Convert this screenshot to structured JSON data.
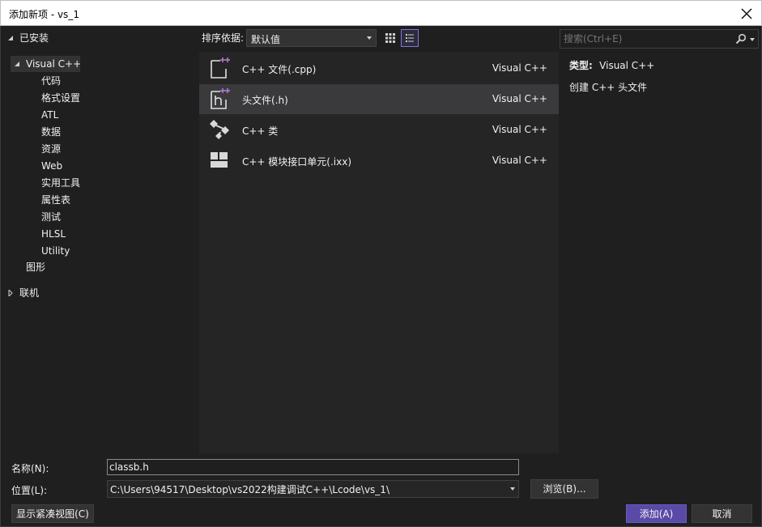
{
  "window": {
    "title": "添加新项 - vs_1"
  },
  "tree": {
    "installed_label": "已安装",
    "visual_cpp_label": "Visual C++",
    "children": [
      "代码",
      "格式设置",
      "ATL",
      "数据",
      "资源",
      "Web",
      "实用工具",
      "属性表",
      "测试",
      "HLSL",
      "Utility"
    ],
    "graphics_label": "图形",
    "online_label": "联机"
  },
  "toolbar": {
    "sort_label": "排序依据:",
    "sort_value": "默认值",
    "search_placeholder": "搜索(Ctrl+E)"
  },
  "templates": [
    {
      "name": "C++ 文件(.cpp)",
      "category": "Visual C++",
      "icon": "cpp-file-icon"
    },
    {
      "name": "头文件(.h)",
      "category": "Visual C++",
      "icon": "header-file-icon"
    },
    {
      "name": "C++ 类",
      "category": "Visual C++",
      "icon": "cpp-class-icon"
    },
    {
      "name": "C++ 模块接口单元(.ixx)",
      "category": "Visual C++",
      "icon": "module-interface-icon"
    }
  ],
  "details": {
    "type_label": "类型:",
    "type_value": "Visual C++",
    "description": "创建 C++ 头文件"
  },
  "form": {
    "name_label": "名称(N):",
    "name_value": "classb.h",
    "location_label": "位置(L):",
    "location_value": "C:\\Users\\94517\\Desktop\\vs2022构建调试C++\\Lcode\\vs_1\\",
    "browse_label": "浏览(B)...",
    "compact_view_label": "显示紧凑视图(C)",
    "add_label": "添加(A)",
    "cancel_label": "取消"
  },
  "colors": {
    "accent": "#5a4aa8",
    "icon_plus": "#b57bd9",
    "background": "#1f1f1f",
    "list_background": "#252526",
    "selected_row": "#3a3a3c"
  }
}
